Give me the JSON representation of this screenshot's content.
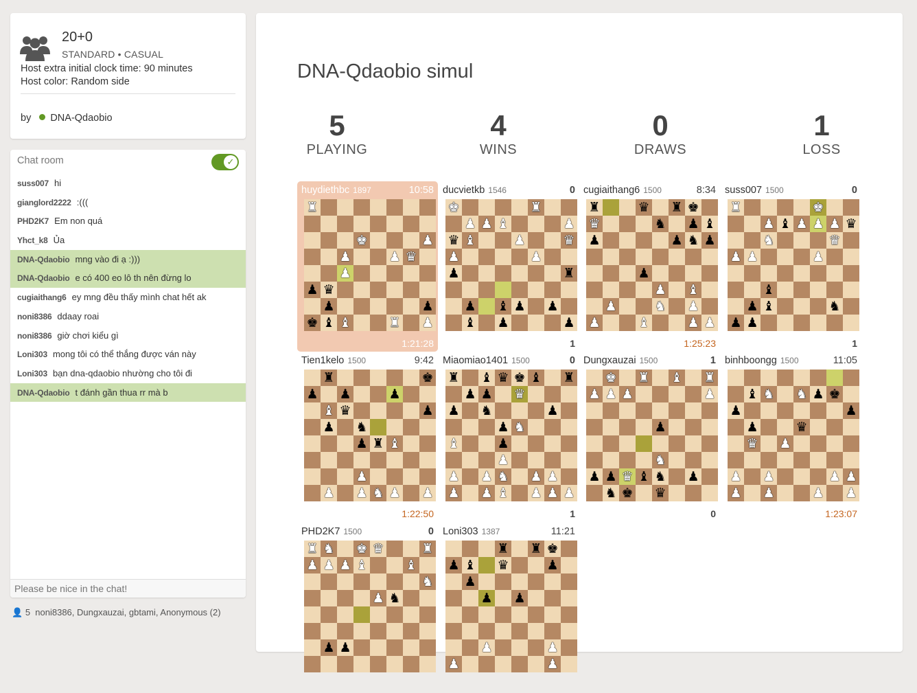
{
  "info": {
    "clock": "20+0",
    "variant": "STANDARD • CASUAL",
    "extra_time": "Host extra initial clock time: 90 minutes",
    "host_color": "Host color: Random side",
    "by_label": "by",
    "host": "DNA-Qdaobio"
  },
  "chat": {
    "title": "Chat room",
    "placeholder": "Please be nice in the chat!",
    "messages": [
      {
        "user": "suss007",
        "text": "hi",
        "host": false
      },
      {
        "user": "gianglord2222",
        "text": ":(((",
        "host": false
      },
      {
        "user": "PHD2K7",
        "text": "Em non quá",
        "host": false
      },
      {
        "user": "Yhct_k8",
        "text": "Ủa",
        "host": false
      },
      {
        "user": "DNA-Qdaobio",
        "text": "mng vào đi ạ :)))",
        "host": true
      },
      {
        "user": "DNA-Qdaobio",
        "text": "e có 400 eo lô th nên đừng lo",
        "host": true
      },
      {
        "user": "cugiaithang6",
        "text": "ey mng đều thấy mình chat hết ak",
        "host": false
      },
      {
        "user": "noni8386",
        "text": "ddaay roai",
        "host": false
      },
      {
        "user": "noni8386",
        "text": "giờ chơi kiểu gì",
        "host": false
      },
      {
        "user": "Loni303",
        "text": "mong tôi có thể thắng được ván này",
        "host": false
      },
      {
        "user": "Loni303",
        "text": "bạn dna-qdaobio nhường cho tôi đi",
        "host": false
      },
      {
        "user": "DNA-Qdaobio",
        "text": "t đánh gần thua rr mà b",
        "host": true
      }
    ]
  },
  "spectators": {
    "count": "5",
    "names": "noni8386, Dungxauzai, gbtami, Anonymous (2)"
  },
  "title": "DNA-Qdaobio simul",
  "stats": [
    {
      "num": "5",
      "label": "PLAYING"
    },
    {
      "num": "4",
      "label": "WINS"
    },
    {
      "num": "0",
      "label": "DRAWS"
    },
    {
      "num": "1",
      "label": "LOSS"
    }
  ],
  "games": [
    {
      "name": "huydiethbc",
      "rating": "1897",
      "top": "10:58",
      "bottom": "1:21:28",
      "hl": true,
      "fen": "R7/8/3K3P/2P2PQ1/2mP4/pq6/1p5p/kbB2R1P/2r4r"
    },
    {
      "name": "ducvietkb",
      "rating": "1546",
      "top": "0",
      "bottom": "1",
      "fen": "K4R2/1PPB3P/qB2P2Q/P4P2/p6r/3m8/1pm1bp1p/1b1p3p/3k1rr1"
    },
    {
      "name": "cugiaithang6",
      "rating": "1500",
      "top": "8:34",
      "bottom": "1:25:23",
      "fen": "rm2q1rk1/Q3n1pbp/p4pnp/8/3p4/4P1B1/1P2N1P1/P2B2PPP/R5RK1"
    },
    {
      "name": "suss007",
      "rating": "1500",
      "top": "0",
      "bottom": "1",
      "fen": "R4mK2/2PbPmPPq/2N3Q1/PP3P2/8/2b5/1pb3n1/pp6/1k4rr"
    },
    {
      "name": "Tien1kelo",
      "rating": "1500",
      "top": "9:42",
      "bottom": "1:22:50",
      "fen": "1r5k/p1p2mp1/1Bq4p/1p1nm3/3prB3/8/3P4/1P1PNP1P/R3Q2K"
    },
    {
      "name": "Miaomiao1401",
      "rating": "1500",
      "top": "0",
      "bottom": "1",
      "fen": "r1bqkb1r/1pp1mQ2/p1n3p1/3pN2m/B2p4/3P4/P1PN1PP1/P1PB1PPP/R3K2R"
    },
    {
      "name": "Dungxauzai",
      "rating": "1500",
      "top": "1",
      "bottom": "0",
      "fen": "1K1R1B1R/PPP4P1P/8/4p3/3m4/4N3/ppmQbn1p/1nk1q3r"
    },
    {
      "name": "binhboongg",
      "rating": "1500",
      "top": "11:05",
      "bottom": "1:23:07",
      "fen": "6m1/1bN1Npk/p6p/1p2q3/1Q1P4/8/P1P3PP/P1P2P1P/R3R1K1"
    },
    {
      "name": "PHD2K7",
      "rating": "1500",
      "top": "0",
      "bottom": "",
      "fen": "RN1KQ2R/PPPB2B1P/7N/4Pn2/3m4/8/1pp5/8"
    },
    {
      "name": "Loni303",
      "rating": "1387",
      "top": "11:21",
      "bottom": "",
      "fen": "3r1rk1/pbm1q2p/1p6/2mp1p2/8/8/2P3P1/P5P1"
    }
  ]
}
